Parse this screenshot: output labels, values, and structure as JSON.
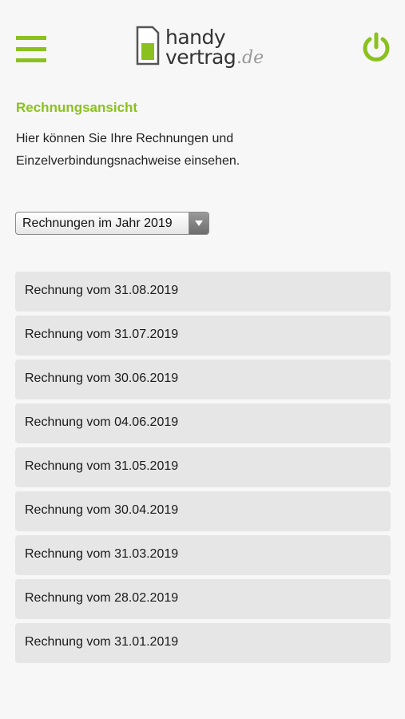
{
  "header": {
    "menu_icon": "hamburger-menu-icon",
    "logo_line1": "handy",
    "logo_line2": "vertrag",
    "logo_suffix": ".de",
    "power_icon": "power-icon",
    "accent_color": "#8bc11f"
  },
  "page": {
    "title": "Rechnungsansicht",
    "intro": "Hier können Sie Ihre Rechnungen und Einzelverbindungsnachweise einsehen."
  },
  "year_select": {
    "selected": "Rechnungen im Jahr 2019"
  },
  "invoices": [
    {
      "label": "Rechnung vom 31.08.2019"
    },
    {
      "label": "Rechnung vom 31.07.2019"
    },
    {
      "label": "Rechnung vom 30.06.2019"
    },
    {
      "label": "Rechnung vom 04.06.2019"
    },
    {
      "label": "Rechnung vom 31.05.2019"
    },
    {
      "label": "Rechnung vom 30.04.2019"
    },
    {
      "label": "Rechnung vom 31.03.2019"
    },
    {
      "label": "Rechnung vom 28.02.2019"
    },
    {
      "label": "Rechnung vom 31.01.2019"
    }
  ]
}
